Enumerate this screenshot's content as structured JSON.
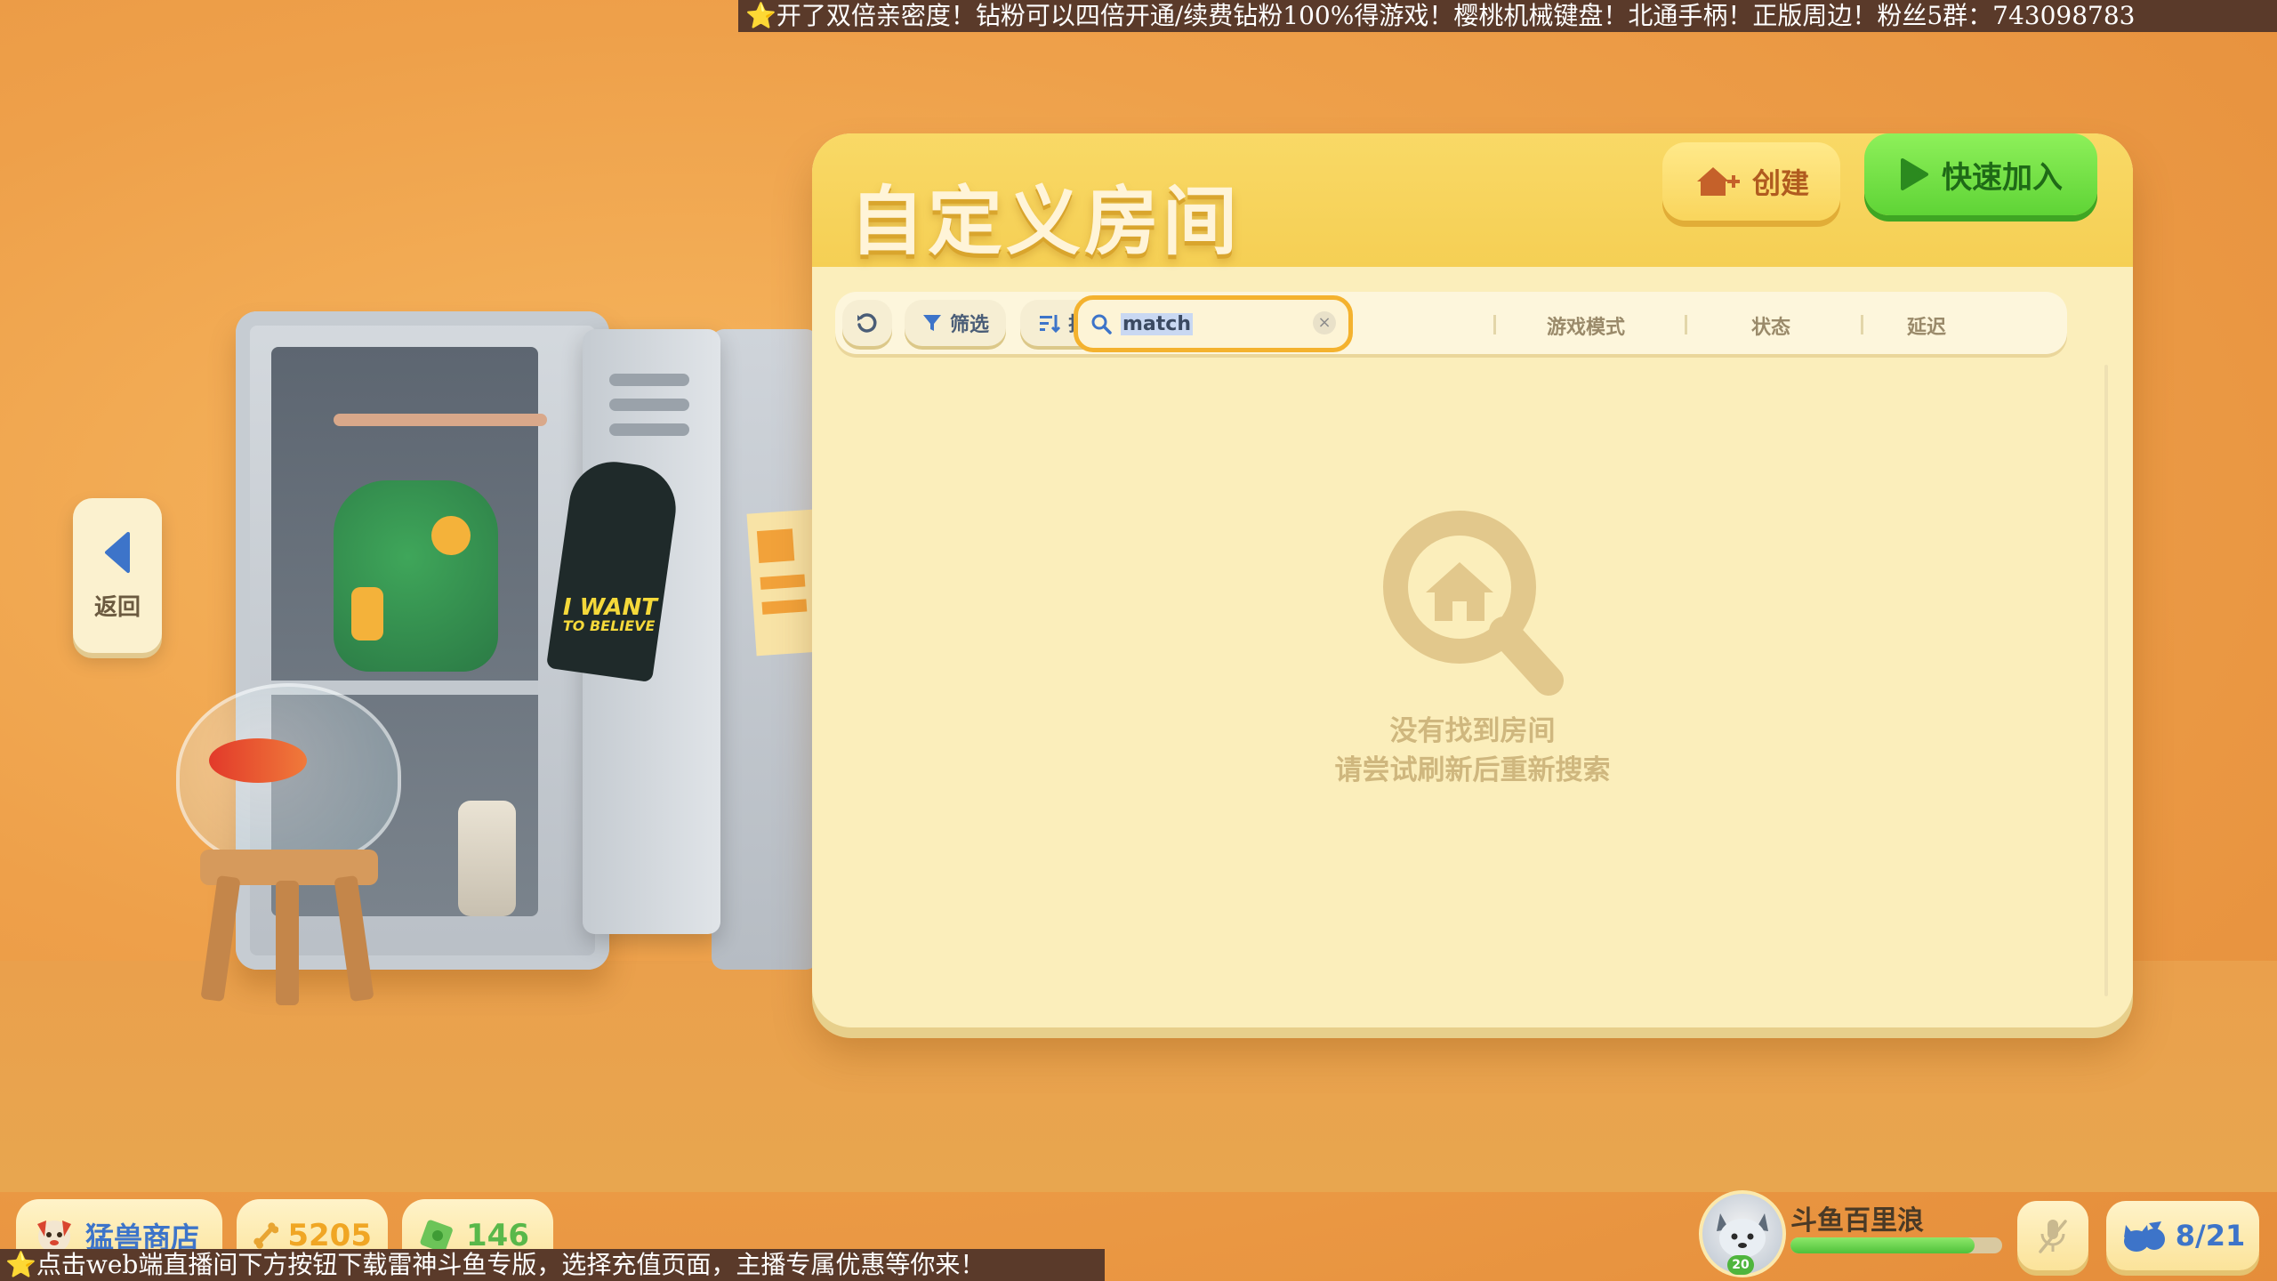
{
  "ticker": {
    "top": "⭐开了双倍亲密度！钻粉可以四倍开通/续费钻粉100%得游戏！樱桃机械键盘！北通手柄！正版周边！粉丝5群：743098783",
    "bottom": "⭐点击web端直播间下方按钮下载雷神斗鱼专版，选择充值页面，主播专属优惠等你来！"
  },
  "nav": {
    "back_label": "返回",
    "back_icon": "chevron-left-icon"
  },
  "panel": {
    "title": "自定义房间",
    "create_label": "创建",
    "quick_join_label": "快速加入",
    "toolbar": {
      "filter_label": "筛选",
      "sort_label": "排序",
      "search_value": "match",
      "clear_symbol": "×"
    },
    "columns": [
      "游戏模式",
      "状态",
      "延迟"
    ],
    "empty_state": {
      "line1": "没有找到房间",
      "line2": "请尝试刷新后重新搜索"
    }
  },
  "scene": {
    "poster_text_1": "I WANT",
    "poster_text_2": "TO BELIEVE"
  },
  "bottom": {
    "shop_label": "猛兽商店",
    "bones": "5205",
    "cash": "146",
    "player_name": "斗鱼百里浪",
    "player_level": "20",
    "xp_fraction": 0.87,
    "friends": "8/21"
  },
  "colors": {
    "panel_bg": "#fbeebb",
    "header_yellow": "#f5cf54",
    "join_green": "#5fd436",
    "accent_orange": "#f4b22e",
    "background_orange": "#eea04a"
  }
}
